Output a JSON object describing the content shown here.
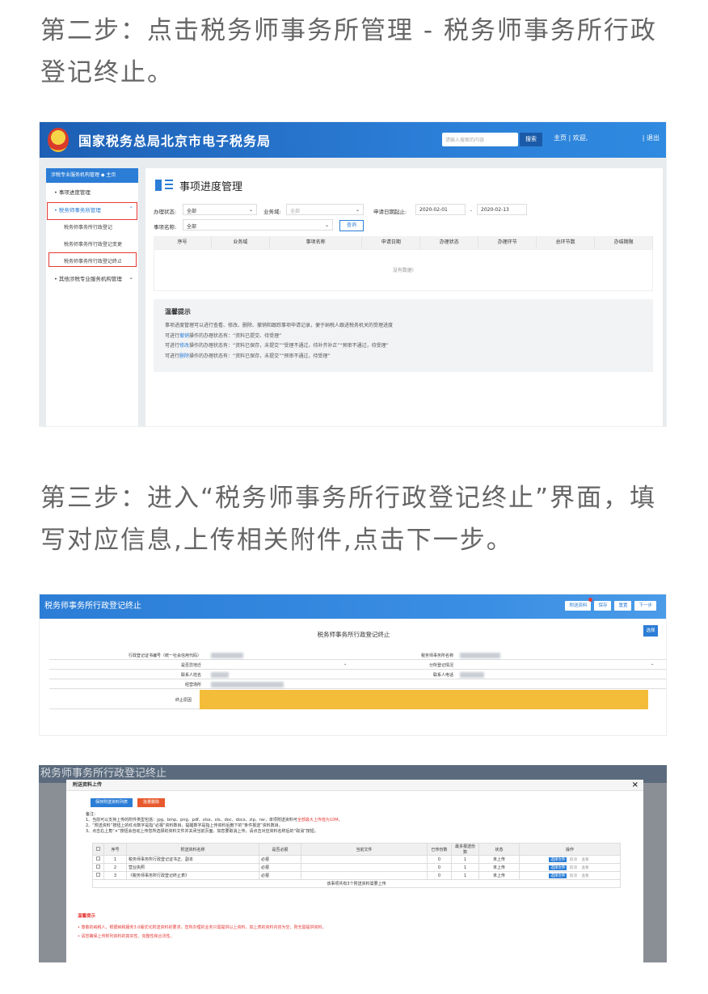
{
  "step2_text": "第二步：点击税务师事务所管理 - 税务师事务所行政登记终止。",
  "step3_text": "第三步：进入“税务师事务所行政登记终止”界面，填写对应信息,上传相关附件,点击下一步。",
  "shot1": {
    "site_title": "国家税务总局北京市电子税务局",
    "search_placeholder": "请输入搜索的内容",
    "search_btn": "搜索",
    "top_links": "主页 | 欢迎,",
    "logout": "| 退出",
    "side_head": "涉税专业服务机构管理 ◆ 主页",
    "side_items": [
      "事项进度管理",
      "税务师事务所管理",
      "其他涉税专业服务机构管理"
    ],
    "side_subitems": [
      "税务师事务所行政登记",
      "税务师事务所行政登记变更",
      "税务师事务所行政登记终止"
    ],
    "page_title": "事项进度管理",
    "filters": {
      "status_label": "办理状态:",
      "status_value": "全部",
      "domain_label": "业务域:",
      "domain_value": "全部",
      "date_label": "申请日期起止:",
      "date_from": "2020-02-01",
      "date_sep": "-",
      "date_to": "2020-02-13",
      "name_label": "事项名称:",
      "name_value": "全部",
      "query_btn": "查询"
    },
    "columns": [
      "序号",
      "业务域",
      "事项名称",
      "申请日期",
      "办理状态",
      "办理环节",
      "总环节数",
      "办结期限"
    ],
    "empty": "没有数据!",
    "tips": {
      "title": "温馨提示",
      "line1": "事项进度管理可以进行查看、修改、删除、撤销和跟踪事项申请记录，便于纳税人跟进税务机关的受理进度",
      "line2_pre": "可进行",
      "line2_link": "撤销",
      "line2_post": "操作的办理状态有：“资料已提交、待受理”",
      "line3_pre": "可进行",
      "line3_link": "修改",
      "line3_post": "操作的办理状态有：“资料已保存，未提交”“受理不通过，待补齐补正”“预审不通过，待受理”",
      "line4_pre": "可进行",
      "line4_link": "删除",
      "line4_post": "操作的办理状态有：“资料已保存，未提交”“预审不通过，待受理”"
    }
  },
  "shot2": {
    "window_title": "税务师事务所行政登记终止",
    "buttons": [
      "附送资料",
      "保存",
      "重置",
      "下一步"
    ],
    "form_title": "税务师事务所行政登记终止",
    "side_btn": "选择",
    "rows": [
      {
        "left": "行政登记证书编号（统一社会信用代码）",
        "right": "税务师事务所名称"
      },
      {
        "left": "是否异地迁",
        "right": "分所登记情况"
      },
      {
        "left": "联系人姓名",
        "right": "联系人电话"
      },
      {
        "left": "经营场所",
        "right": ""
      },
      {
        "left": "终止原因",
        "right": ""
      }
    ]
  },
  "shot3": {
    "bg_title": "税务师事务所行政登记终止",
    "dialog_title": "附送资料上传",
    "btn_save": "保存附送资料列表",
    "btn_delete": "批量删除",
    "notes": [
      "备注：",
      "1、当前可以支持上传的附件类型包括：jpg、bmp、png、pdf、xlsx、xls、doc、docx、zip、rar，单项附送资料可",
      "2、“附送资料”按钮上的红点数字是指“必报”资料数目，提醒数字是指上传资料后删下的“条件报送”资料数目。",
      "3、点击右上角“×”按钮会自动上传您所选择的资料文件并关闭当前页面，如您要取消上传，请点击对应资料名称后的“取消”按钮。"
    ],
    "note_red": "全部最大上传值为10M。",
    "headers": [
      "序号",
      "附送资料名称",
      "是否必报",
      "当前文件",
      "已传份数",
      "最多报送份数",
      "状态",
      "操作"
    ],
    "rows": [
      {
        "no": "1",
        "name": "税务师事务所行政登记证书正、副本",
        "req": "必报",
        "file": "",
        "count": "0",
        "max": "1",
        "status": "未上传"
      },
      {
        "no": "2",
        "name": "营业执照",
        "req": "必报",
        "file": "",
        "count": "0",
        "max": "1",
        "status": "未上传"
      },
      {
        "no": "3",
        "name": "《税务师事务所行政登记终止表》",
        "req": "必报",
        "file": "",
        "count": "0",
        "max": "1",
        "status": "未上传"
      }
    ],
    "ops": [
      "选择文件",
      "取消",
      "查看"
    ],
    "footer": "该事项共有3个附送资料需要上传",
    "warm_title": "温馨提示",
    "warm_lines": [
      "• 尊敬的纳税人，根据纳税服务3.0版优化附送资料的要求，您所办理的业务只需提供以上资料，如上表的资料内容为空，则无需提供资料。",
      "• 请您确保上传附列资料的真实性、完整性和合法性。"
    ]
  }
}
